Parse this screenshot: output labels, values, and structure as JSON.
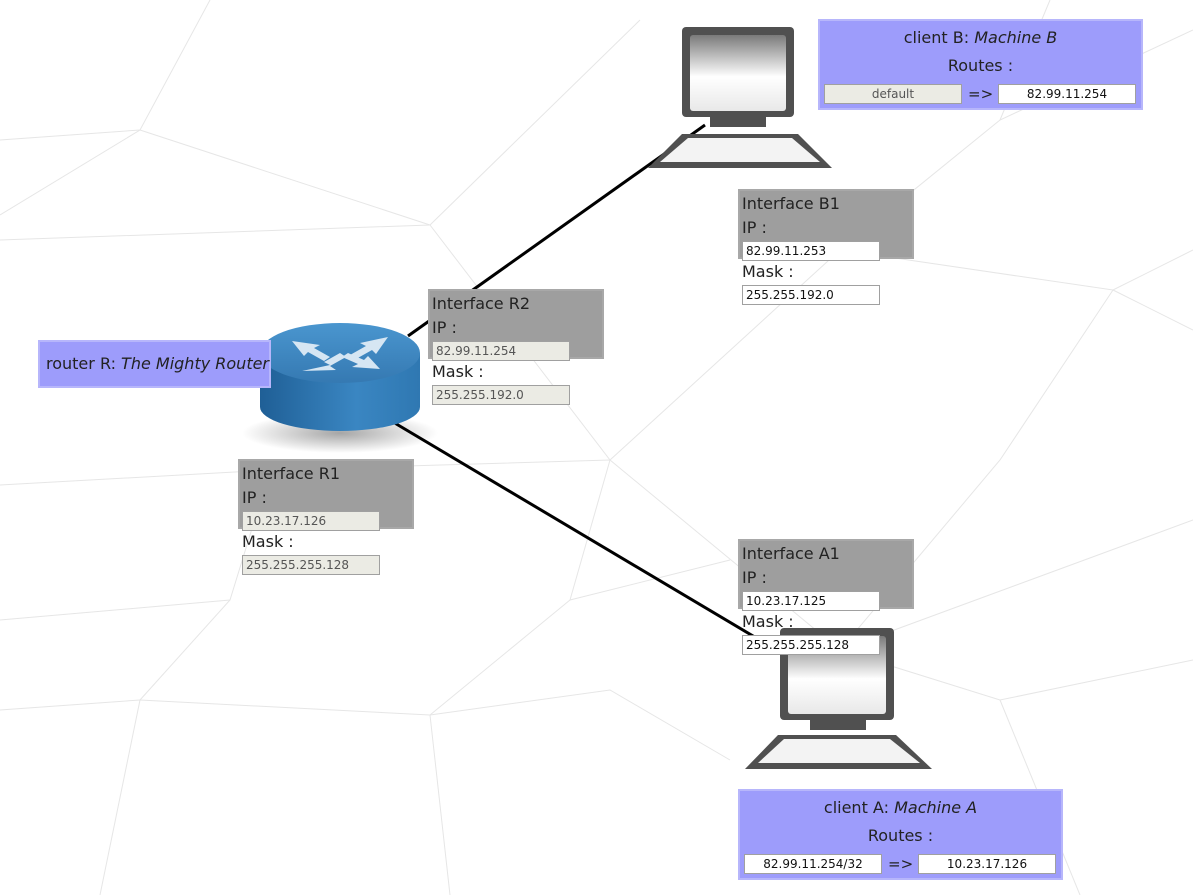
{
  "router": {
    "kind_label": "router R:",
    "name": "The Mighty Router",
    "interfaces": [
      {
        "title": "Interface R2",
        "ip_label": "IP :",
        "ip": "82.99.11.254",
        "mask_label": "Mask :",
        "mask": "255.255.192.0",
        "editable": false
      },
      {
        "title": "Interface R1",
        "ip_label": "IP :",
        "ip": "10.23.17.126",
        "mask_label": "Mask :",
        "mask": "255.255.255.128",
        "editable": false
      }
    ]
  },
  "client_b": {
    "kind_label": "client B:",
    "name": "Machine B",
    "routes_label": "Routes :",
    "route": {
      "destination": "default",
      "arrow": "=>",
      "gateway": "82.99.11.254"
    },
    "interface": {
      "title": "Interface B1",
      "ip_label": "IP :",
      "ip": "82.99.11.253",
      "mask_label": "Mask :",
      "mask": "255.255.192.0",
      "editable": true
    }
  },
  "client_a": {
    "kind_label": "client A:",
    "name": "Machine A",
    "routes_label": "Routes :",
    "route": {
      "destination": "82.99.11.254/32",
      "arrow": "=>",
      "gateway": "10.23.17.126"
    },
    "interface": {
      "title": "Interface A1",
      "ip_label": "IP :",
      "ip": "10.23.17.125",
      "mask_label": "Mask :",
      "mask": "255.255.255.128",
      "editable": true
    }
  },
  "colors": {
    "host_label_bg": "#9d9cfb",
    "interface_bg": "#9e9e9e",
    "link": "#000000",
    "router_top": "#3d86c0",
    "router_side": "#2b6fa8"
  }
}
